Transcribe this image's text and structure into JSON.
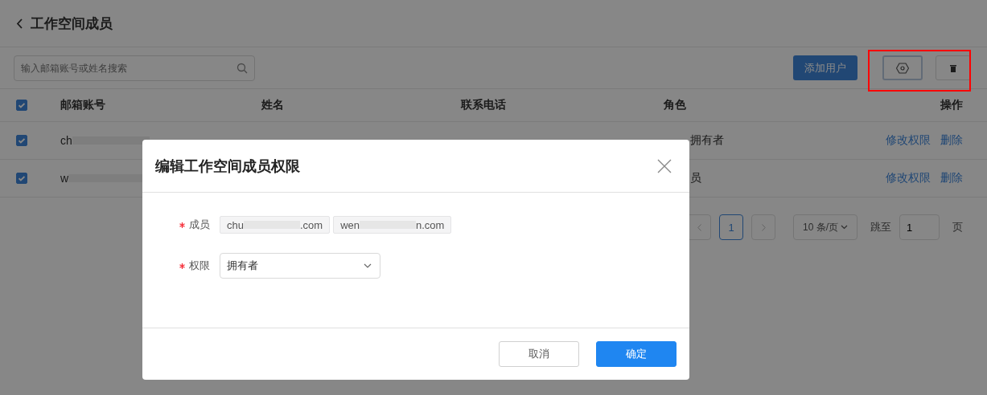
{
  "page": {
    "title": "工作空间成员"
  },
  "toolbar": {
    "search": {
      "placeholder": "输入邮箱账号或姓名搜索"
    },
    "add_button": "添加用户"
  },
  "table": {
    "all_checked": true,
    "columns": [
      "邮箱账号",
      "姓名",
      "联系电话",
      "角色",
      "操作"
    ],
    "rows": [
      {
        "checked": true,
        "email": "ch",
        "role": "拥有者",
        "actions": [
          "修改权限",
          "删除"
        ]
      },
      {
        "checked": true,
        "email": "w",
        "role": "员",
        "actions": [
          "修改权限",
          "删除"
        ]
      }
    ]
  },
  "pagination": {
    "current": "1",
    "page_size": "10 条/页",
    "jump_label": "跳至",
    "jump_value": "1",
    "page_unit": "页"
  },
  "dialog": {
    "title": "编辑工作空间成员权限",
    "fields": [
      {
        "kind": "tags",
        "label": "成员",
        "required": true,
        "tags": [
          {
            "prefix": "chu",
            "suffix": ".com"
          },
          {
            "prefix": "wen",
            "suffix": "n.com"
          }
        ]
      },
      {
        "kind": "select",
        "label": "权限",
        "required": true,
        "value": "拥有者"
      }
    ],
    "buttons": [
      {
        "label": "取消",
        "primary": false
      },
      {
        "label": "确定",
        "primary": true
      }
    ]
  }
}
